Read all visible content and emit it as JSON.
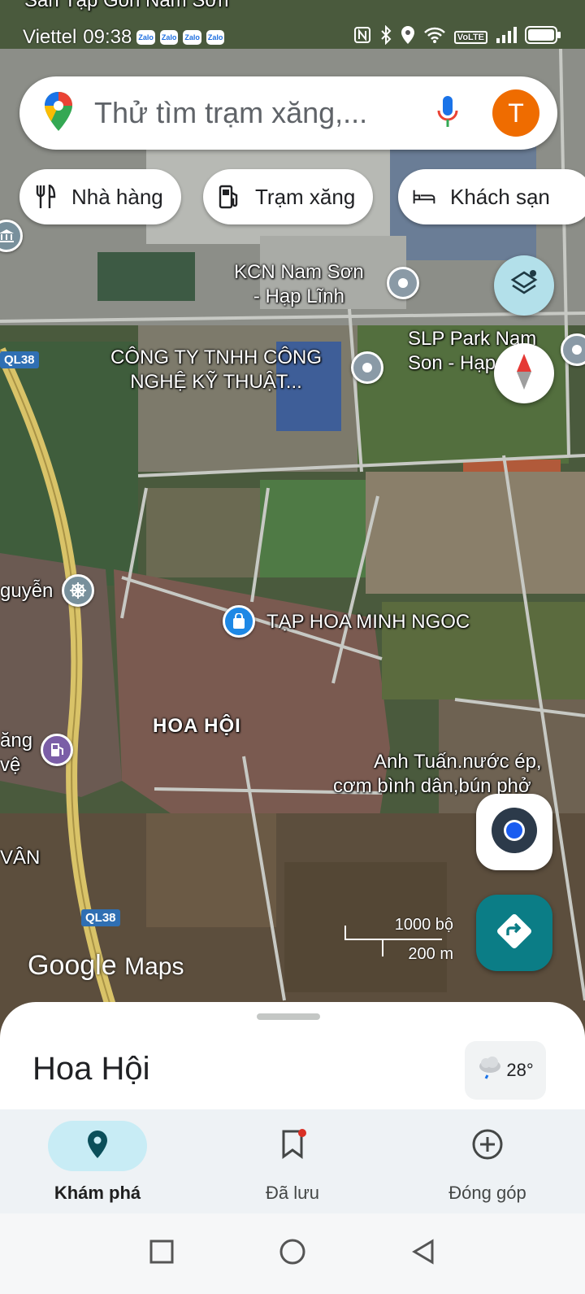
{
  "status_bar": {
    "carrier": "Viettel",
    "time": "09:38",
    "notifications": [
      "Zalo",
      "Zalo",
      "Zalo",
      "Zalo"
    ],
    "network_badge": "VoLTE"
  },
  "search": {
    "placeholder": "Thử tìm trạm xăng,..."
  },
  "account": {
    "avatar_initial": "T",
    "avatar_color": "#ef6c00"
  },
  "chips": [
    {
      "label": "Nhà hàng",
      "icon": "restaurant-icon"
    },
    {
      "label": "Trạm xăng",
      "icon": "gas-station-icon"
    },
    {
      "label": "Khách sạn",
      "icon": "hotel-icon"
    }
  ],
  "map": {
    "top_partial_label": "Sàn Tạp Gôn Nam Sơn",
    "places": {
      "kcn_line1": "KCN Nam Sơn",
      "kcn_line2": "- Hạp Lĩnh",
      "slp_line1": "SLP Park Nam",
      "slp_line2": "Son - Hạp",
      "company_line1": "CÔNG TY TNHH CÔNG",
      "company_line2": "NGHỆ KỸ THUẬT...",
      "nguyen": "guyễn",
      "tap_hoa": "TẠP HOA MINH NGOC",
      "hoa_hoi": "HOA HỘI",
      "ang_line1": "ăng",
      "ang_line2": "vệ",
      "anh_tuan_line1": "Anh Tuấn.nước ép,",
      "anh_tuan_line2": "cơm bình dân,bún phở",
      "van": "VÂN"
    },
    "road_shields": [
      "QL38",
      "QL38"
    ]
  },
  "scale": {
    "imperial": "1000 bộ",
    "metric": "200 m"
  },
  "logo": {
    "google": "Google",
    "maps": "Maps"
  },
  "sheet": {
    "place_name": "Hoa Hội",
    "temperature": "28°"
  },
  "bottom_nav": [
    {
      "label": "Khám phá",
      "active": true
    },
    {
      "label": "Đã lưu",
      "active": false
    },
    {
      "label": "Đóng góp",
      "active": false
    }
  ],
  "colors": {
    "primary_teal": "#0b7d86",
    "layers_bg": "#b3e0ea",
    "nav_active_pill": "#c8ecf5"
  }
}
